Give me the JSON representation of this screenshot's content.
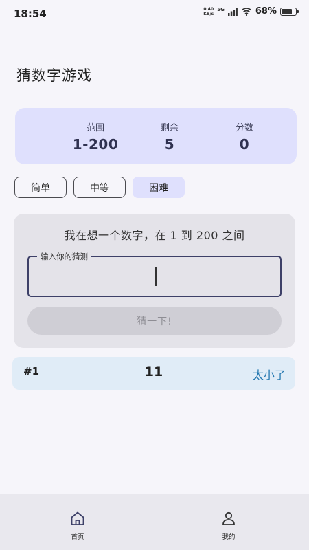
{
  "status_bar": {
    "time": "18:54",
    "net_speed_value": "0.40",
    "net_speed_unit": "KB/s",
    "signal_label": "5G",
    "battery": "68%"
  },
  "title": "猜数字游戏",
  "stats": {
    "range_label": "范围",
    "range_value": "1-200",
    "remaining_label": "剩余",
    "remaining_value": "5",
    "score_label": "分数",
    "score_value": "0"
  },
  "difficulty": {
    "easy": "简单",
    "medium": "中等",
    "hard": "困难",
    "selected": "困难"
  },
  "game": {
    "prompt": "我在想一个数字，在 1 到 200 之间",
    "input_label": "输入你的猜测",
    "input_value": "",
    "guess_button": "猜一下!"
  },
  "history": [
    {
      "index": "#1",
      "guess": "11",
      "result": "太小了"
    }
  ],
  "nav": {
    "home": "首页",
    "mine": "我的"
  },
  "colors": {
    "accent_card": "#dfe0fd",
    "input_border": "#3d4068",
    "result_text": "#2377b0"
  }
}
